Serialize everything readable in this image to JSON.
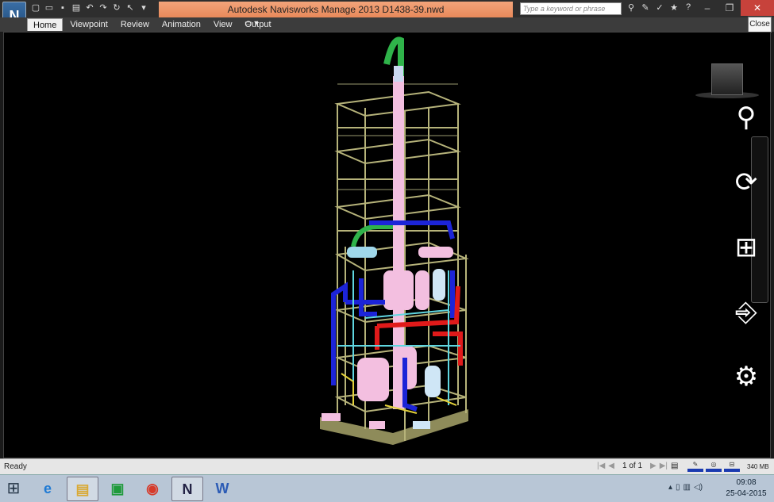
{
  "app": {
    "title": "Autodesk Navisworks Manage 2013    D1438-39.nwd",
    "menu_button_label": "N"
  },
  "qat": {
    "items": [
      "new-icon",
      "open-icon",
      "save-icon",
      "print-icon",
      "undo-icon",
      "redo-icon",
      "refresh-icon",
      "select-icon",
      "dropdown-icon"
    ]
  },
  "search": {
    "placeholder": "Type a keyword or phrase"
  },
  "ribbon": {
    "tabs": [
      {
        "label": "Home",
        "active": true
      },
      {
        "label": "Viewpoint",
        "active": false
      },
      {
        "label": "Review",
        "active": false
      },
      {
        "label": "Animation",
        "active": false
      },
      {
        "label": "View",
        "active": false
      },
      {
        "label": "Output",
        "active": false
      }
    ],
    "extra": "▭ ▾"
  },
  "tooltip": {
    "close_label": "Close"
  },
  "status": {
    "text": "Ready",
    "page": "1 of 1",
    "memory": "340 MB"
  },
  "colors": {
    "structure": "#b6b37a",
    "pipe_blue": "#1c24d8",
    "pipe_red": "#e01a1a",
    "pipe_green": "#2fb34a",
    "vessel_pink": "#f3bfe0",
    "cyan": "#5fd6e0"
  },
  "taskbar": {
    "items": [
      {
        "name": "internet-explorer-icon",
        "glyph": "e",
        "color": "#1f7ad4",
        "active": false
      },
      {
        "name": "file-explorer-icon",
        "glyph": "▤",
        "color": "#d9a933",
        "active": true
      },
      {
        "name": "store-icon",
        "glyph": "▣",
        "color": "#1e9a3a",
        "active": false
      },
      {
        "name": "chrome-icon",
        "glyph": "◉",
        "color": "#d63a2a",
        "active": false
      },
      {
        "name": "navisworks-icon",
        "glyph": "N",
        "color": "#224",
        "active": true
      },
      {
        "name": "word-icon",
        "glyph": "W",
        "color": "#2b5bb5",
        "active": false
      }
    ],
    "time": "09:08",
    "date": "25-04-2015"
  }
}
